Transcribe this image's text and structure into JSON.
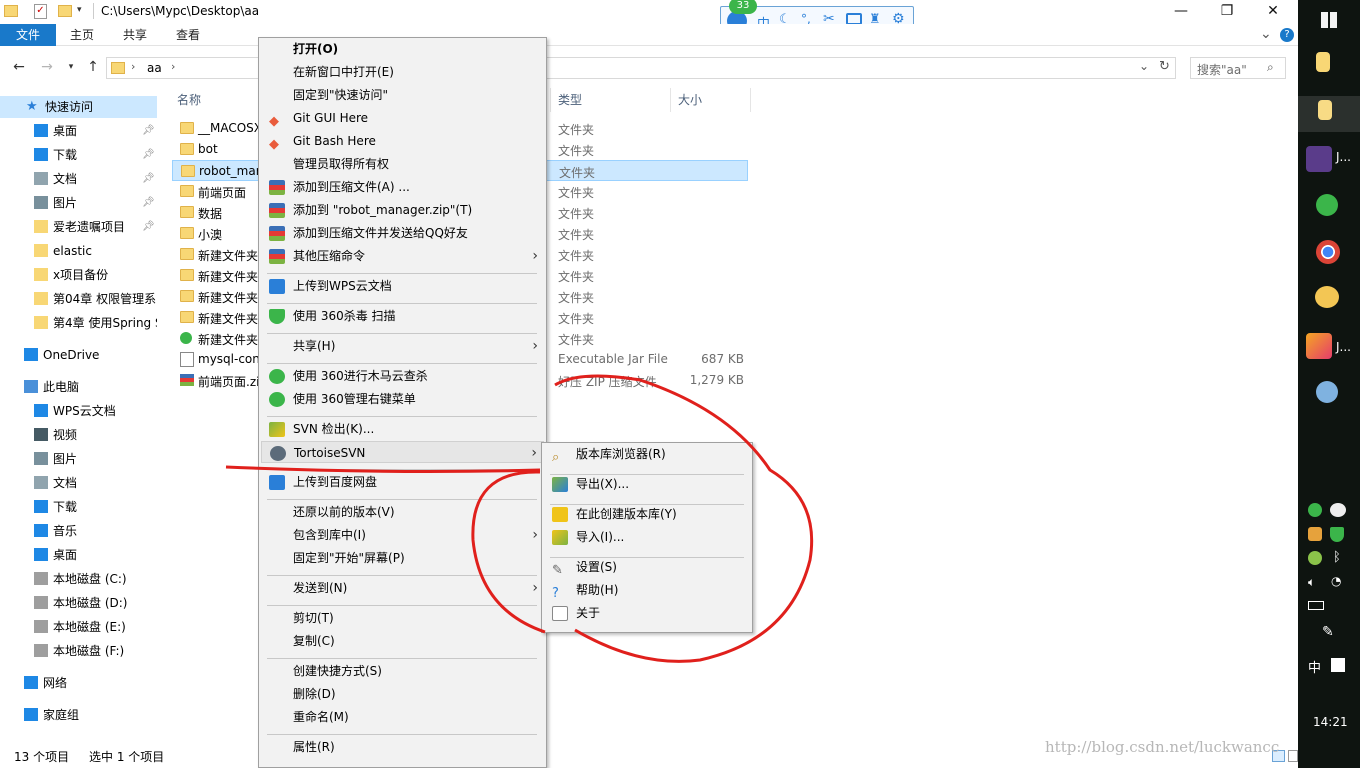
{
  "window": {
    "path": "C:\\Users\\Mypc\\Desktop\\aa",
    "controls": {
      "minimize": "—",
      "maximize": "❐",
      "close": "✕"
    }
  },
  "ribbon": {
    "tabs": [
      "文件",
      "主页",
      "共享",
      "查看"
    ],
    "collapse": "⌄",
    "help": "?"
  },
  "address": {
    "crumb": "aa",
    "search_placeholder": "搜索\"aa\""
  },
  "sidebar": {
    "items": [
      {
        "label": "快速访问",
        "icon": "star-icon",
        "pinned": false
      },
      {
        "label": "桌面",
        "icon": "desktop-icon",
        "pinned": true
      },
      {
        "label": "下载",
        "icon": "download-icon",
        "pinned": true
      },
      {
        "label": "文档",
        "icon": "document-icon",
        "pinned": true
      },
      {
        "label": "图片",
        "icon": "picture-icon",
        "pinned": true
      },
      {
        "label": "爱老遗嘱项目",
        "icon": "folder-icon",
        "pinned": true
      },
      {
        "label": "elastic",
        "icon": "folder-icon",
        "pinned": false
      },
      {
        "label": "x项目备份",
        "icon": "folder-icon",
        "pinned": false
      },
      {
        "label": "第04章 权限管理系",
        "icon": "folder-icon",
        "pinned": false
      },
      {
        "label": "第4章 使用Spring S",
        "icon": "folder-icon",
        "pinned": false
      },
      {
        "label": "OneDrive",
        "icon": "cloud-icon",
        "pinned": false
      },
      {
        "label": "此电脑",
        "icon": "computer-icon",
        "pinned": false
      },
      {
        "label": "WPS云文档",
        "icon": "cloud-icon",
        "pinned": false
      },
      {
        "label": "视频",
        "icon": "video-icon",
        "pinned": false
      },
      {
        "label": "图片",
        "icon": "picture-icon",
        "pinned": false
      },
      {
        "label": "文档",
        "icon": "document-icon",
        "pinned": false
      },
      {
        "label": "下载",
        "icon": "download-icon",
        "pinned": false
      },
      {
        "label": "音乐",
        "icon": "music-icon",
        "pinned": false
      },
      {
        "label": "桌面",
        "icon": "desktop-icon",
        "pinned": false
      },
      {
        "label": "本地磁盘 (C:)",
        "icon": "drive-icon",
        "pinned": false
      },
      {
        "label": "本地磁盘 (D:)",
        "icon": "drive-icon",
        "pinned": false
      },
      {
        "label": "本地磁盘 (E:)",
        "icon": "drive-icon",
        "pinned": false
      },
      {
        "label": "本地磁盘 (F:)",
        "icon": "drive-icon",
        "pinned": false
      },
      {
        "label": "网络",
        "icon": "network-icon",
        "pinned": false
      },
      {
        "label": "家庭组",
        "icon": "homegroup-icon",
        "pinned": false
      }
    ]
  },
  "list": {
    "headers": {
      "name": "名称",
      "type": "类型",
      "size": "大小"
    },
    "rows": [
      {
        "name": "__MACOSX",
        "type": "文件夹",
        "size": "",
        "icon": "folder-icon"
      },
      {
        "name": "bot",
        "type": "文件夹",
        "size": "",
        "icon": "folder-icon"
      },
      {
        "name": "robot_mar",
        "type": "文件夹",
        "size": "",
        "icon": "folder-icon",
        "selected": true
      },
      {
        "name": "前端页面",
        "type": "文件夹",
        "size": "",
        "icon": "folder-icon"
      },
      {
        "name": "数据",
        "type": "文件夹",
        "size": "",
        "icon": "folder-icon"
      },
      {
        "name": "小澳",
        "type": "文件夹",
        "size": "",
        "icon": "folder-icon"
      },
      {
        "name": "新建文件夹",
        "type": "文件夹",
        "size": "",
        "icon": "folder-icon"
      },
      {
        "name": "新建文件夹",
        "type": "文件夹",
        "size": "",
        "icon": "folder-icon"
      },
      {
        "name": "新建文件夹",
        "type": "文件夹",
        "size": "",
        "icon": "folder-icon"
      },
      {
        "name": "新建文件夹",
        "type": "文件夹",
        "size": "",
        "icon": "folder-icon"
      },
      {
        "name": "新建文件夹",
        "type": "文件夹",
        "size": "",
        "icon": "folder-svn-icon"
      },
      {
        "name": "mysql-con",
        "type": "Executable Jar File",
        "size": "687 KB",
        "icon": "jar-icon"
      },
      {
        "name": "前端页面.zi",
        "type": "好压 ZIP 压缩文件",
        "size": "1,279 KB",
        "icon": "zip-icon"
      }
    ]
  },
  "status": {
    "count": "13 个项目",
    "selected": "选中 1 个项目"
  },
  "context_menu": {
    "items": [
      {
        "label": "打开(O)",
        "bold": true,
        "icon": ""
      },
      {
        "label": "在新窗口中打开(E)",
        "icon": ""
      },
      {
        "label": "固定到\"快速访问\"",
        "icon": ""
      },
      {
        "label": "Git GUI Here",
        "icon": "git-icon"
      },
      {
        "label": "Git Bash Here",
        "icon": "git-icon"
      },
      {
        "label": "管理员取得所有权",
        "icon": ""
      },
      {
        "label": "添加到压缩文件(A) ...",
        "icon": "winrar-icon"
      },
      {
        "label": "添加到 \"robot_manager.zip\"(T)",
        "icon": "winrar-icon"
      },
      {
        "label": "添加到压缩文件并发送给QQ好友",
        "icon": "winrar-icon"
      },
      {
        "label": "其他压缩命令",
        "icon": "winrar-icon",
        "submenu": true
      },
      {
        "label": "上传到WPS云文档",
        "icon": "wps-icon"
      },
      {
        "label": "使用 360杀毒 扫描",
        "icon": "shield-icon"
      },
      {
        "label": "共享(H)",
        "icon": "",
        "submenu": true
      },
      {
        "label": "使用 360进行木马云查杀",
        "icon": "plus-icon"
      },
      {
        "label": "使用 360管理右键菜单",
        "icon": "plus-icon"
      },
      {
        "label": "SVN 检出(K)...",
        "icon": "svn-icon"
      },
      {
        "label": "TortoiseSVN",
        "icon": "tortoise-icon",
        "submenu": true,
        "highlighted": true
      },
      {
        "label": "上传到百度网盘",
        "icon": "baidu-icon"
      },
      {
        "label": "还原以前的版本(V)",
        "icon": ""
      },
      {
        "label": "包含到库中(I)",
        "icon": "",
        "submenu": true
      },
      {
        "label": "固定到\"开始\"屏幕(P)",
        "icon": ""
      },
      {
        "label": "发送到(N)",
        "icon": "",
        "submenu": true
      },
      {
        "label": "剪切(T)",
        "icon": ""
      },
      {
        "label": "复制(C)",
        "icon": ""
      },
      {
        "label": "创建快捷方式(S)",
        "icon": ""
      },
      {
        "label": "删除(D)",
        "icon": ""
      },
      {
        "label": "重命名(M)",
        "icon": ""
      },
      {
        "label": "属性(R)",
        "icon": ""
      }
    ]
  },
  "submenu": {
    "items": [
      {
        "label": "版本库浏览器(R)",
        "icon": "repo-browser-icon"
      },
      {
        "label": "导出(X)...",
        "icon": "export-icon"
      },
      {
        "label": "在此创建版本库(Y)",
        "icon": "create-repo-icon"
      },
      {
        "label": "导入(I)...",
        "icon": "import-icon"
      },
      {
        "label": "设置(S)",
        "icon": "settings-icon"
      },
      {
        "label": "帮助(H)",
        "icon": "help-icon"
      },
      {
        "label": "关于",
        "icon": "about-icon"
      }
    ]
  },
  "floating_toolbar": {
    "badge": "33"
  },
  "taskbar": {
    "apps": [
      {
        "label": "J...",
        "icon": "app-icon"
      },
      {
        "label": "J...",
        "icon": "pdf-icon"
      }
    ],
    "ime": "中",
    "clock": "14:21"
  },
  "watermark": "http://blog.csdn.net/luckwancc",
  "colors": {
    "accent": "#1979ca",
    "selection": "#cce8ff",
    "annotation": "#e0201c"
  }
}
